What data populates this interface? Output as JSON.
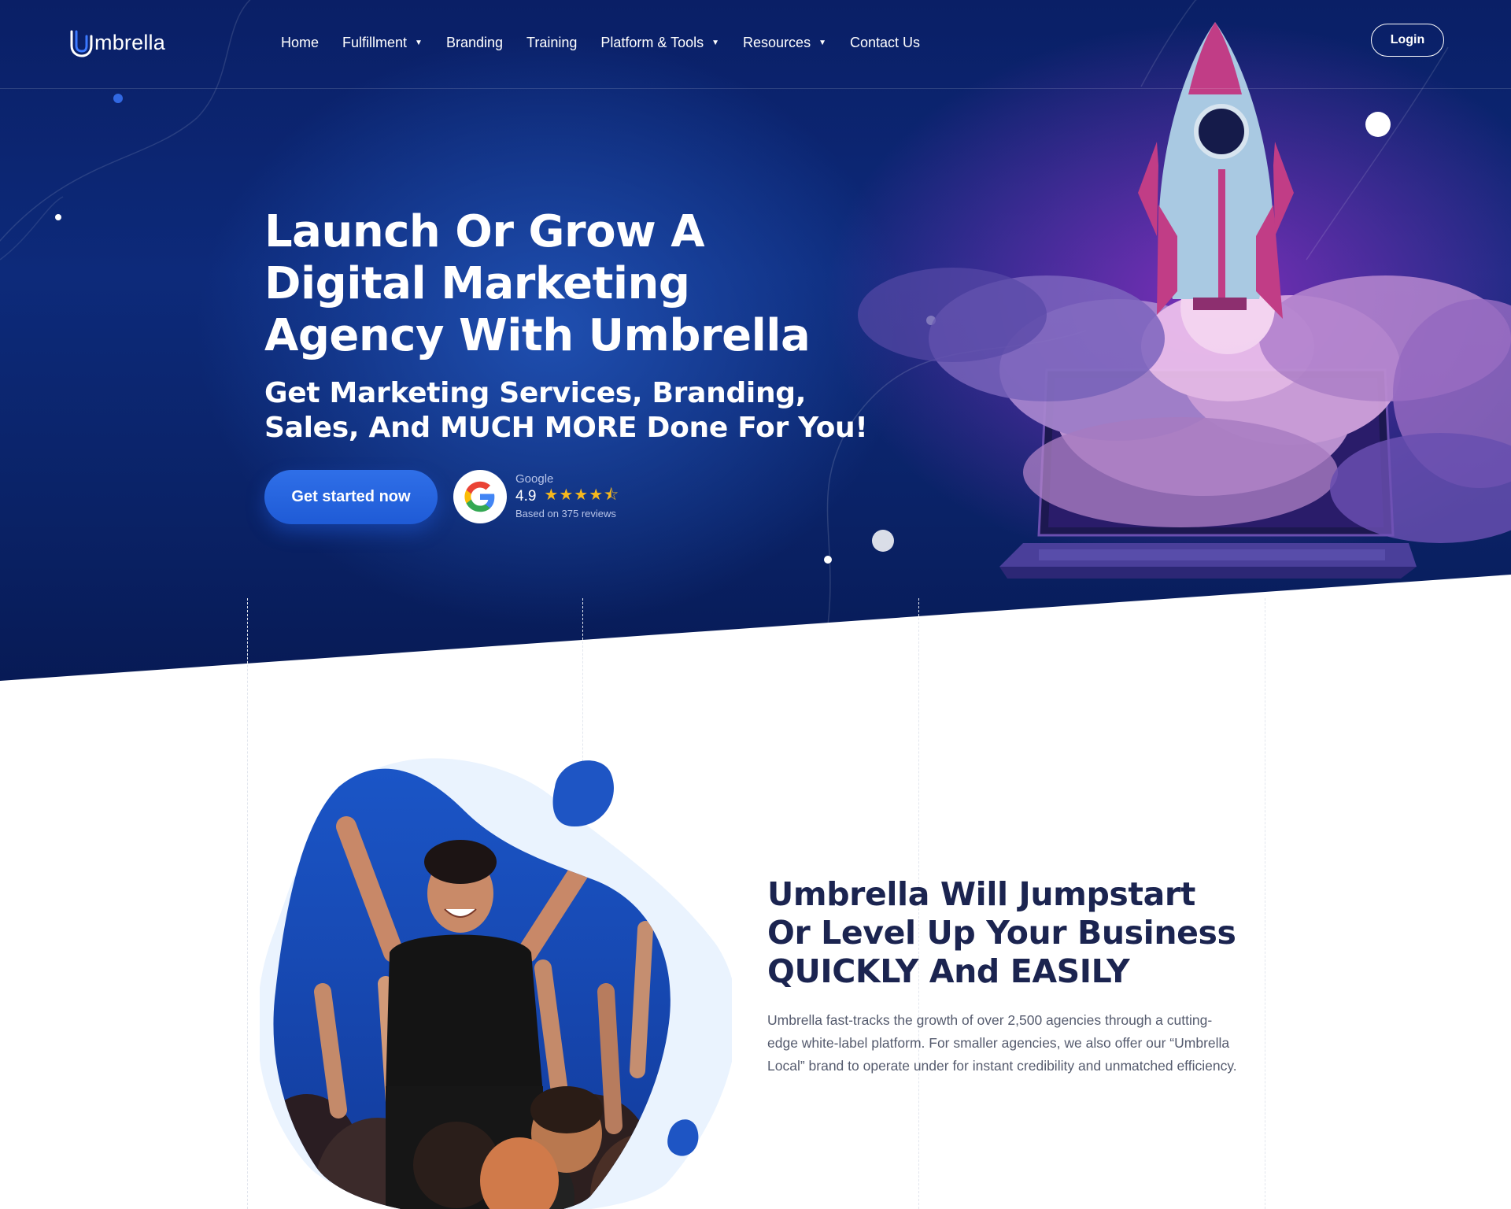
{
  "nav": {
    "logo_text": "mbrella",
    "items": [
      {
        "label": "Home",
        "dropdown": false
      },
      {
        "label": "Fulfillment",
        "dropdown": true
      },
      {
        "label": "Branding",
        "dropdown": false
      },
      {
        "label": "Training",
        "dropdown": false
      },
      {
        "label": "Platform & Tools",
        "dropdown": true
      },
      {
        "label": "Resources",
        "dropdown": true
      },
      {
        "label": "Contact Us",
        "dropdown": false
      }
    ],
    "login_label": "Login"
  },
  "hero": {
    "headline": "Launch Or Grow A Digital Marketing Agency With Umbrella",
    "subheadline": "Get Marketing Services, Branding, Sales, And MUCH MORE Done For You!",
    "cta_label": "Get started now",
    "review": {
      "source": "Google",
      "score": "4.9",
      "stars": "★★★★⯪",
      "count_text": "Based on 375 reviews"
    }
  },
  "section2": {
    "title": "Umbrella Will Jumpstart Or Level Up Your Business QUICKLY And EASILY",
    "body": "Umbrella fast-tracks the growth of over 2,500 agencies through a cutting-edge white-label platform. For smaller agencies, we also offer our “Umbrella Local” brand to operate under for instant credibility and unmatched efficiency."
  },
  "colors": {
    "hero_bg": "#0a2266",
    "accent": "#2f6fe8",
    "star": "#f6b81d",
    "heading_dark": "#1b2450",
    "body_text": "#555b6e"
  }
}
